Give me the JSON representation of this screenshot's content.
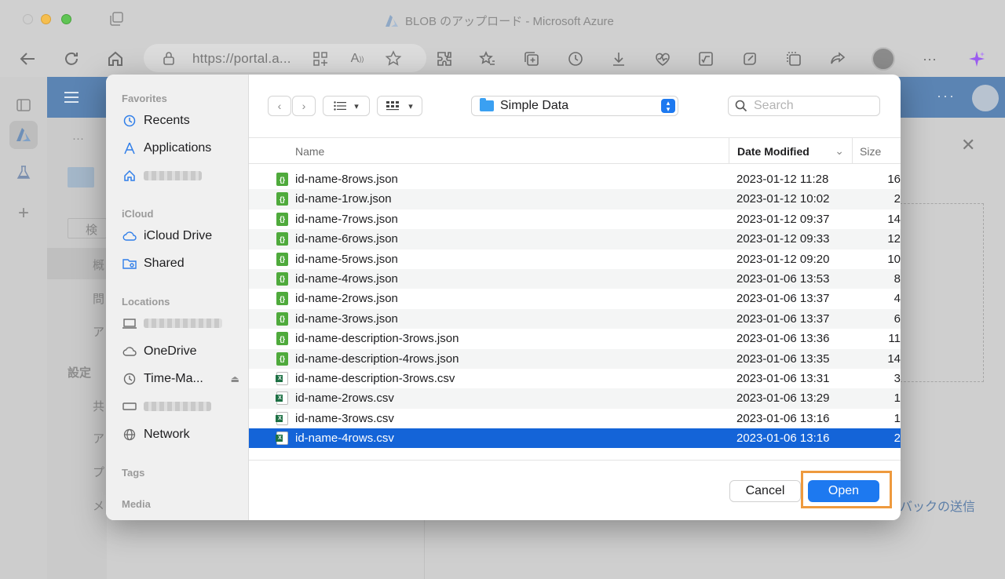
{
  "browser": {
    "tab_title": "BLOB のアップロード - Microsoft Azure",
    "url": "https://portal.a..."
  },
  "azure": {
    "breadcrumb_more": "···",
    "search_placeholder": "検",
    "menu": [
      "概",
      "問",
      "ア"
    ],
    "section_settings": "設定",
    "settings_items": [
      "共",
      "ア",
      "プ",
      "メ"
    ],
    "feedback": "バックの送信",
    "header_more": "···"
  },
  "dialog": {
    "sidebar": {
      "favorites_label": "Favorites",
      "favorites": [
        {
          "label": "Recents",
          "icon": "clock-icon"
        },
        {
          "label": "Applications",
          "icon": "applications-icon"
        },
        {
          "label": "",
          "icon": "home-icon",
          "redacted": true
        }
      ],
      "icloud_label": "iCloud",
      "icloud": [
        {
          "label": "iCloud Drive",
          "icon": "cloud-icon"
        },
        {
          "label": "Shared",
          "icon": "shared-folder-icon"
        }
      ],
      "locations_label": "Locations",
      "locations": [
        {
          "label": "",
          "icon": "laptop-icon",
          "redacted": true
        },
        {
          "label": "OneDrive",
          "icon": "cloud-icon"
        },
        {
          "label": "Time-Ma...",
          "icon": "time-machine-icon"
        },
        {
          "label": "",
          "icon": "drive-icon",
          "redacted": true
        },
        {
          "label": "Network",
          "icon": "globe-icon"
        }
      ],
      "tags_label": "Tags",
      "media_label": "Media"
    },
    "current_folder": "Simple Data",
    "search_placeholder": "Search",
    "columns": {
      "name": "Name",
      "date": "Date Modified",
      "size": "Size"
    },
    "files": [
      {
        "name": "id-name-8rows.json",
        "date": "2023-01-12 11:28",
        "size": "16",
        "type": "json"
      },
      {
        "name": "id-name-1row.json",
        "date": "2023-01-12 10:02",
        "size": "2",
        "type": "json"
      },
      {
        "name": "id-name-7rows.json",
        "date": "2023-01-12 09:37",
        "size": "14",
        "type": "json"
      },
      {
        "name": "id-name-6rows.json",
        "date": "2023-01-12 09:33",
        "size": "12",
        "type": "json"
      },
      {
        "name": "id-name-5rows.json",
        "date": "2023-01-12 09:20",
        "size": "10",
        "type": "json"
      },
      {
        "name": "id-name-4rows.json",
        "date": "2023-01-06 13:53",
        "size": "8",
        "type": "json"
      },
      {
        "name": "id-name-2rows.json",
        "date": "2023-01-06 13:37",
        "size": "4",
        "type": "json"
      },
      {
        "name": "id-name-3rows.json",
        "date": "2023-01-06 13:37",
        "size": "6",
        "type": "json"
      },
      {
        "name": "id-name-description-3rows.json",
        "date": "2023-01-06 13:36",
        "size": "11",
        "type": "json"
      },
      {
        "name": "id-name-description-4rows.json",
        "date": "2023-01-06 13:35",
        "size": "14",
        "type": "json"
      },
      {
        "name": "id-name-description-3rows.csv",
        "date": "2023-01-06 13:31",
        "size": "3",
        "type": "csv"
      },
      {
        "name": "id-name-2rows.csv",
        "date": "2023-01-06 13:29",
        "size": "1",
        "type": "csv"
      },
      {
        "name": "id-name-3rows.csv",
        "date": "2023-01-06 13:16",
        "size": "1",
        "type": "csv"
      },
      {
        "name": "id-name-4rows.csv",
        "date": "2023-01-06 13:16",
        "size": "2",
        "type": "csv",
        "selected": true
      }
    ],
    "cancel_label": "Cancel",
    "open_label": "Open"
  },
  "colors": {
    "accent": "#1d79f0",
    "selection": "#1464d8",
    "highlight": "#ee9a3e",
    "azure_header": "#5b84b3"
  }
}
